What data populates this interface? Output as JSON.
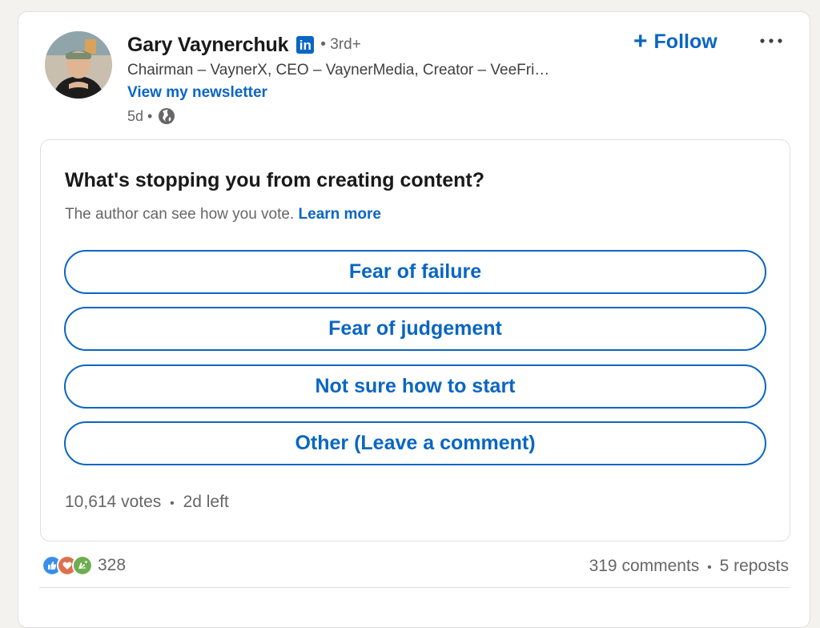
{
  "post": {
    "author_name": "Gary Vaynerchuk",
    "badge_text": "in",
    "degree": "• 3rd+",
    "headline": "Chairman – VaynerX, CEO – VaynerMedia, Creator – VeeFri…",
    "newsletter_link": "View my newsletter",
    "age": "5d •",
    "visibility_icon": "globe-icon",
    "follow_label": "Follow",
    "more_icon": "more-horizontal-icon"
  },
  "poll": {
    "question": "What's stopping you from creating content?",
    "note": "The author can see how you vote.",
    "learn_more": "Learn more",
    "options": [
      {
        "label": "Fear of failure"
      },
      {
        "label": "Fear of judgement"
      },
      {
        "label": "Not sure how to start"
      },
      {
        "label": "Other (Leave a comment)"
      }
    ],
    "votes": "10,614 votes",
    "separator": "•",
    "time_left": "2d left"
  },
  "social": {
    "reaction_count": "328",
    "reaction_icons": [
      "like-icon",
      "love-icon",
      "celebrate-icon"
    ],
    "comments": "319 comments",
    "separator": "•",
    "reposts": "5 reposts"
  },
  "colors": {
    "accent": "#0a66c2",
    "background": "#f4f2ee",
    "card": "#ffffff",
    "muted_text": "#666666"
  }
}
